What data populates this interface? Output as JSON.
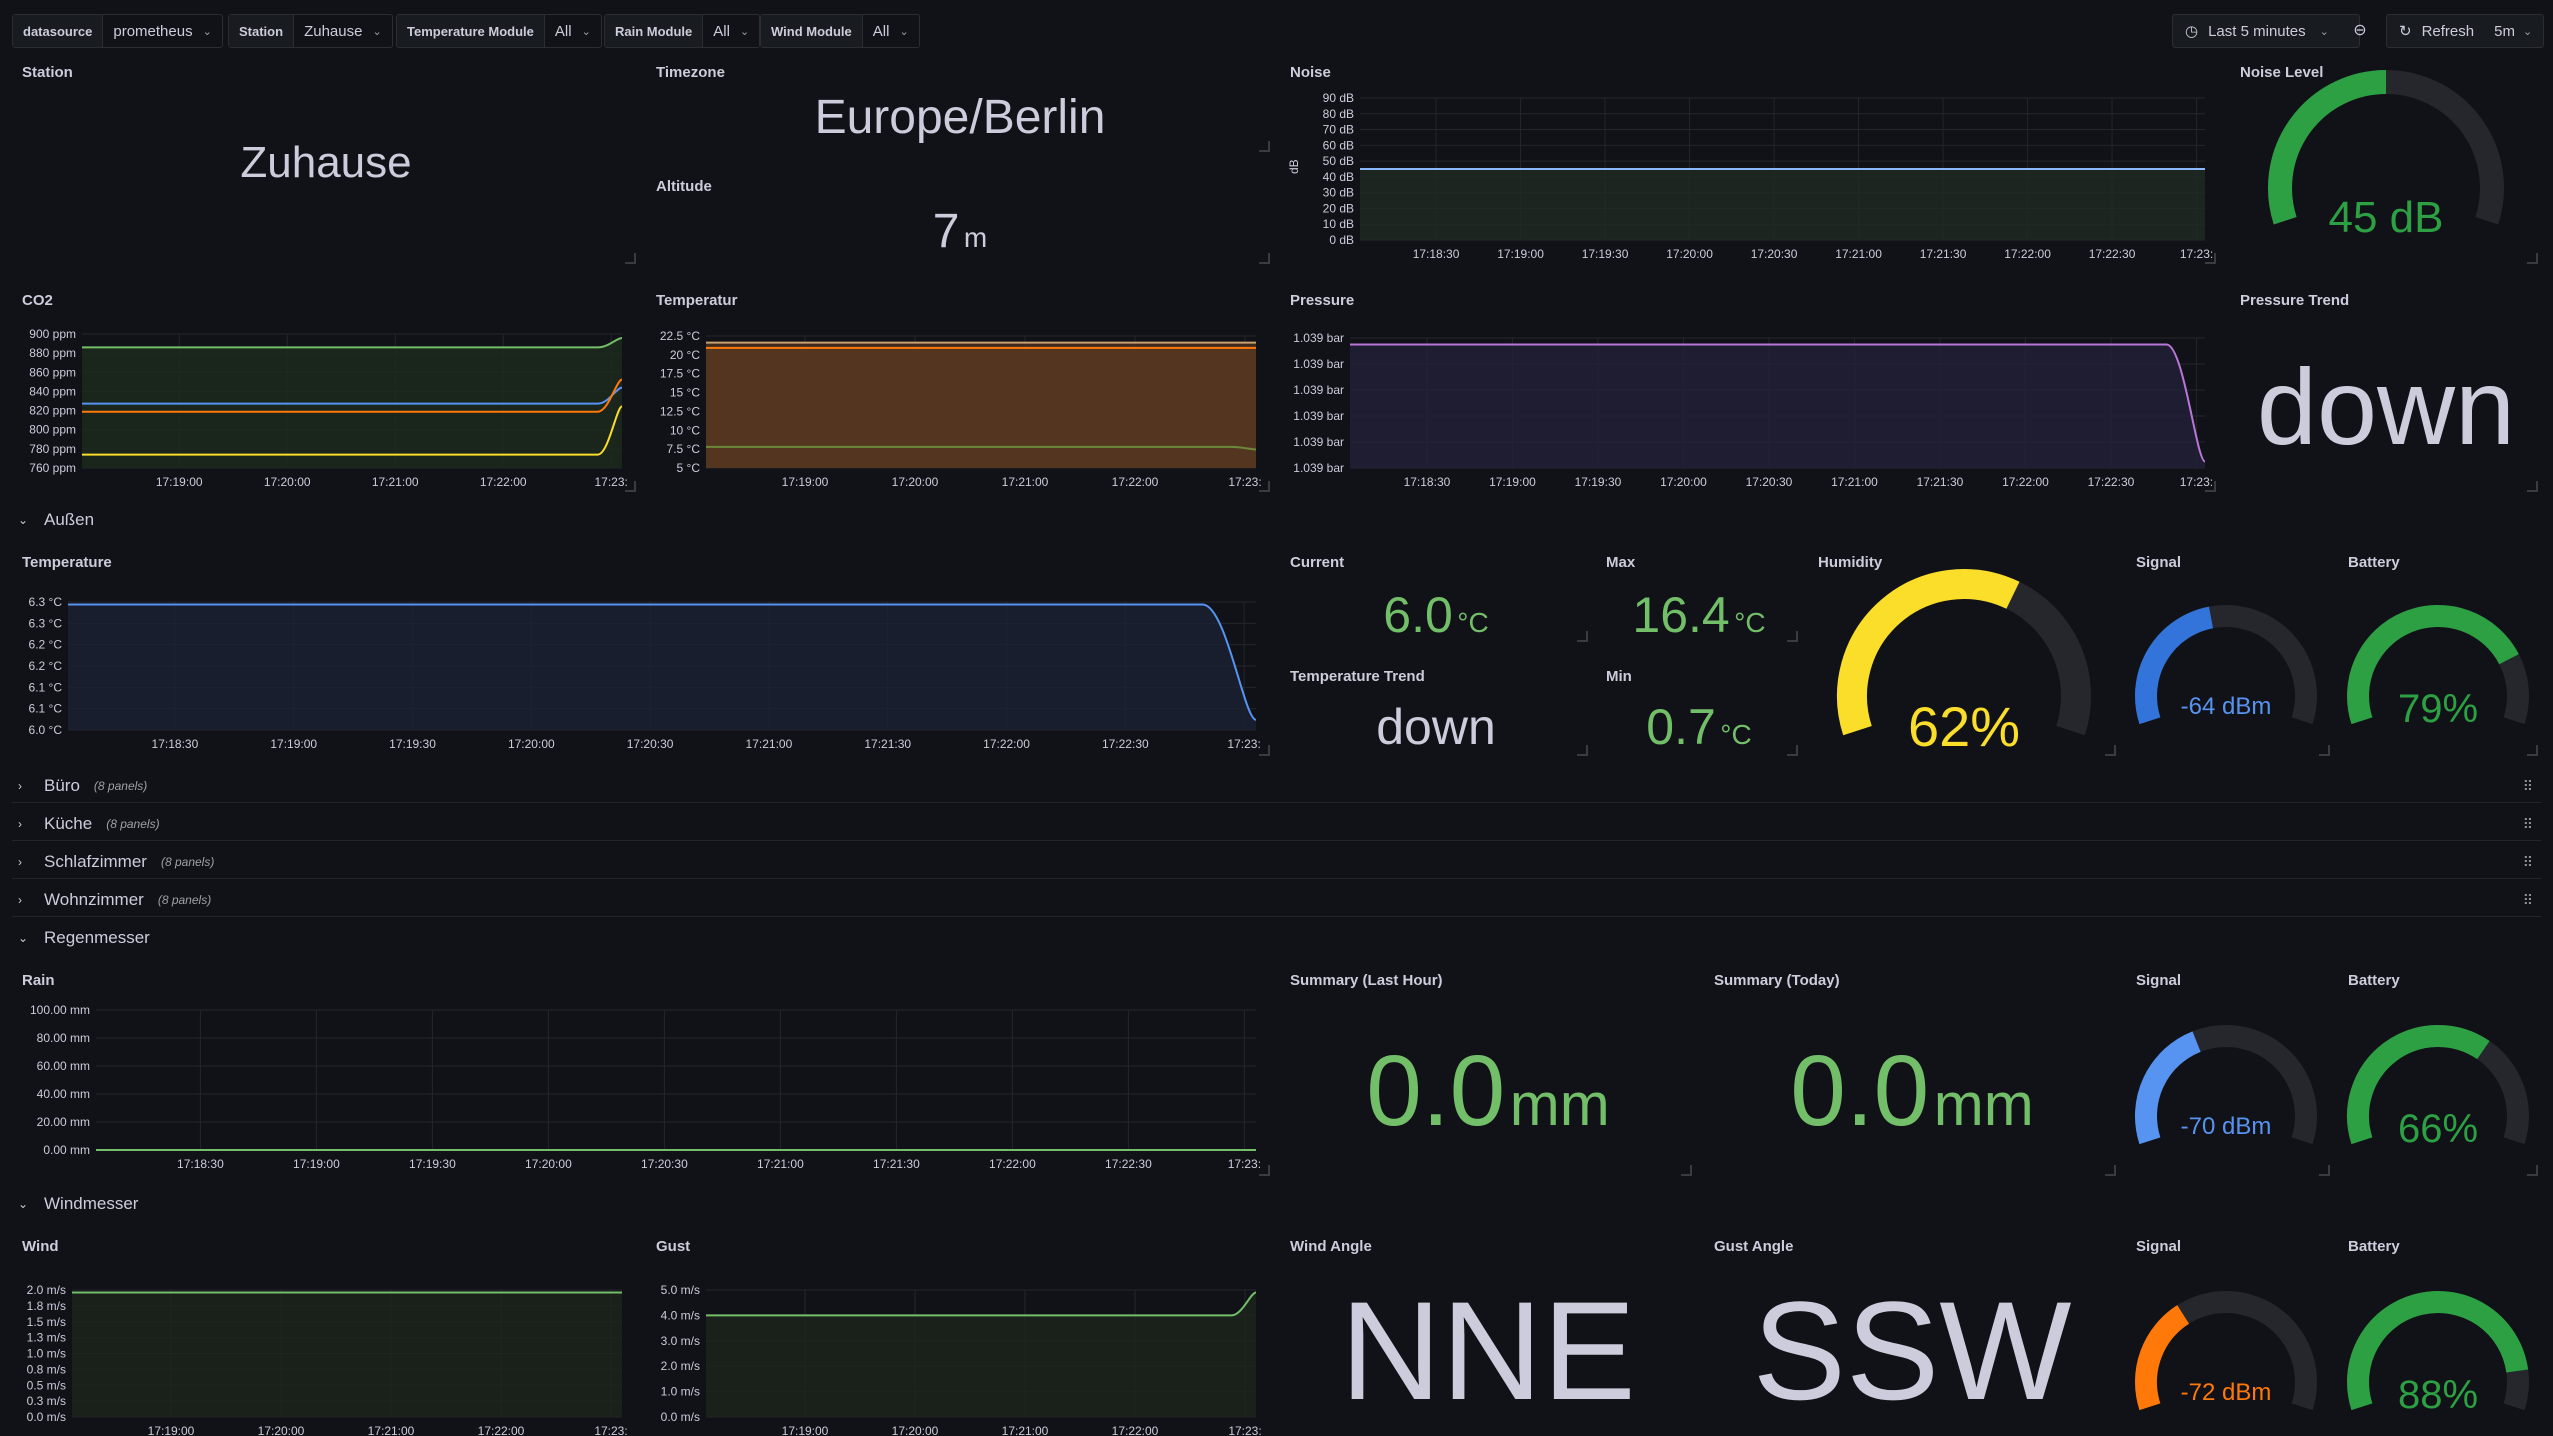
{
  "topbar": {
    "vars": [
      {
        "label": "datasource",
        "value": "prometheus"
      },
      {
        "label": "Station",
        "value": "Zuhause"
      },
      {
        "label": "Temperature Module",
        "value": "All"
      },
      {
        "label": "Rain Module",
        "value": "All"
      },
      {
        "label": "Wind Module",
        "value": "All"
      }
    ],
    "time_range": "Last 5 minutes",
    "refresh": "Refresh",
    "refresh_interval": "5m"
  },
  "panels": {
    "station": {
      "title": "Station",
      "value": "Zuhause"
    },
    "timezone": {
      "title": "Timezone",
      "value": "Europe/Berlin"
    },
    "altitude": {
      "title": "Altitude",
      "value": "7",
      "unit": "m"
    },
    "noise": {
      "title": "Noise",
      "ylabel": "dB",
      "yticks": [
        "90 dB",
        "80 dB",
        "70 dB",
        "60 dB",
        "50 dB",
        "40 dB",
        "30 dB",
        "20 dB",
        "10 dB",
        "0 dB"
      ],
      "xticks": [
        "17:18:30",
        "17:19:00",
        "17:19:30",
        "17:20:00",
        "17:20:30",
        "17:21:00",
        "17:21:30",
        "17:22:00",
        "17:22:30",
        "17:23:"
      ]
    },
    "noise_level": {
      "title": "Noise Level",
      "value": "45 dB",
      "fraction": 0.5
    },
    "co2": {
      "title": "CO2",
      "yticks": [
        "900 ppm",
        "880 ppm",
        "860 ppm",
        "840 ppm",
        "820 ppm",
        "800 ppm",
        "780 ppm",
        "760 ppm"
      ],
      "xticks": [
        "17:19:00",
        "17:20:00",
        "17:21:00",
        "17:22:00",
        "17:23:"
      ]
    },
    "temperatur": {
      "title": "Temperatur",
      "yticks": [
        "22.5 °C",
        "20 °C",
        "17.5 °C",
        "15 °C",
        "12.5 °C",
        "10 °C",
        "7.5 °C",
        "5 °C"
      ],
      "xticks": [
        "17:19:00",
        "17:20:00",
        "17:21:00",
        "17:22:00",
        "17:23:"
      ]
    },
    "pressure": {
      "title": "Pressure",
      "yticks": [
        "1.039 bar",
        "1.039 bar",
        "1.039 bar",
        "1.039 bar",
        "1.039 bar",
        "1.039 bar"
      ],
      "xticks": [
        "17:18:30",
        "17:19:00",
        "17:19:30",
        "17:20:00",
        "17:20:30",
        "17:21:00",
        "17:21:30",
        "17:22:00",
        "17:22:30",
        "17:23:"
      ]
    },
    "pressure_trend": {
      "title": "Pressure Trend",
      "value": "down"
    }
  },
  "rows": {
    "aussen": {
      "title": "Außen",
      "temperature": {
        "title": "Temperature",
        "yticks": [
          "6.3 °C",
          "6.3 °C",
          "6.2 °C",
          "6.2 °C",
          "6.1 °C",
          "6.1 °C",
          "6.0 °C"
        ],
        "xticks": [
          "17:18:30",
          "17:19:00",
          "17:19:30",
          "17:20:00",
          "17:20:30",
          "17:21:00",
          "17:21:30",
          "17:22:00",
          "17:22:30",
          "17:23:"
        ]
      },
      "current": {
        "title": "Current",
        "value": "6.0",
        "unit": "°C"
      },
      "max": {
        "title": "Max",
        "value": "16.4",
        "unit": "°C"
      },
      "trend": {
        "title": "Temperature Trend",
        "value": "down"
      },
      "min": {
        "title": "Min",
        "value": "0.7",
        "unit": "°C"
      },
      "humidity": {
        "title": "Humidity",
        "value": "62%",
        "fraction": 0.62
      },
      "signal": {
        "title": "Signal",
        "value": "-64 dBm",
        "fraction": 0.45
      },
      "battery": {
        "title": "Battery",
        "value": "79%",
        "fraction": 0.79
      }
    },
    "collapsed": [
      {
        "title": "Büro",
        "count": "(8 panels)"
      },
      {
        "title": "Küche",
        "count": "(8 panels)"
      },
      {
        "title": "Schlafzimmer",
        "count": "(8 panels)"
      },
      {
        "title": "Wohnzimmer",
        "count": "(8 panels)"
      }
    ],
    "regen": {
      "title": "Regenmesser",
      "rain": {
        "title": "Rain",
        "yticks": [
          "100.00 mm",
          "80.00 mm",
          "60.00 mm",
          "40.00 mm",
          "20.00 mm",
          "0.00 mm"
        ],
        "xticks": [
          "17:18:30",
          "17:19:00",
          "17:19:30",
          "17:20:00",
          "17:20:30",
          "17:21:00",
          "17:21:30",
          "17:22:00",
          "17:22:30",
          "17:23:"
        ]
      },
      "summary_hour": {
        "title": "Summary (Last Hour)",
        "value": "0.0",
        "unit": "mm"
      },
      "summary_today": {
        "title": "Summary (Today)",
        "value": "0.0",
        "unit": "mm"
      },
      "signal": {
        "title": "Signal",
        "value": "-70 dBm",
        "fraction": 0.4
      },
      "battery": {
        "title": "Battery",
        "value": "66%",
        "fraction": 0.66
      }
    },
    "wind": {
      "title": "Windmesser",
      "wind": {
        "title": "Wind",
        "yticks": [
          "2.0 m/s",
          "1.8 m/s",
          "1.5 m/s",
          "1.3 m/s",
          "1.0 m/s",
          "0.8 m/s",
          "0.5 m/s",
          "0.3 m/s",
          "0.0 m/s"
        ],
        "xticks": [
          "17:19:00",
          "17:20:00",
          "17:21:00",
          "17:22:00",
          "17:23:"
        ]
      },
      "gust": {
        "title": "Gust",
        "yticks": [
          "5.0 m/s",
          "4.0 m/s",
          "3.0 m/s",
          "2.0 m/s",
          "1.0 m/s",
          "0.0 m/s"
        ],
        "xticks": [
          "17:19:00",
          "17:20:00",
          "17:21:00",
          "17:22:00",
          "17:23:"
        ]
      },
      "wind_angle": {
        "title": "Wind Angle",
        "value": "NNE"
      },
      "gust_angle": {
        "title": "Gust Angle",
        "value": "SSW"
      },
      "signal": {
        "title": "Signal",
        "value": "-72 dBm",
        "fraction": 0.35
      },
      "battery": {
        "title": "Battery",
        "value": "88%",
        "fraction": 0.88
      }
    }
  },
  "colors": {
    "green": "#73bf69",
    "yellow": "#fade2a",
    "blue": "#5794f2",
    "orange": "#ff780a",
    "purple": "#b877d9"
  }
}
